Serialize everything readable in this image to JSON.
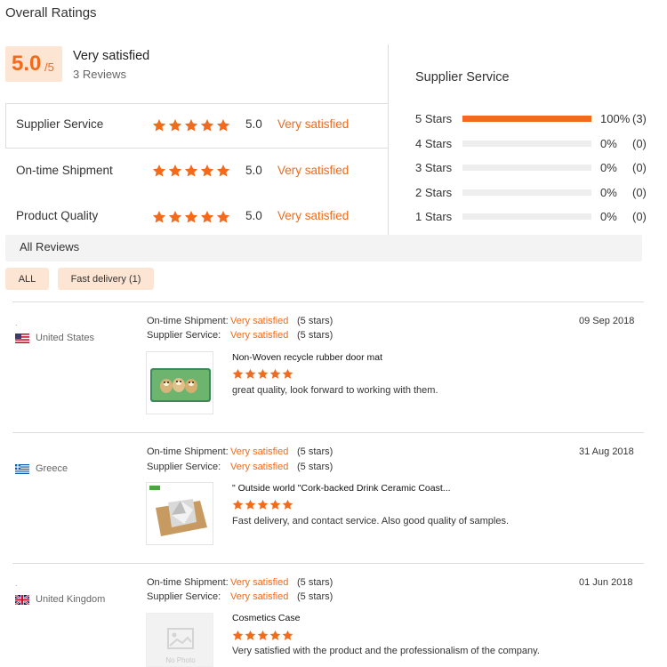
{
  "overall": {
    "title": "Overall Ratings",
    "score": "5.0",
    "score_max": "/5",
    "label": "Very satisfied",
    "count": "3 Reviews"
  },
  "ratings": [
    {
      "label": "Supplier Service",
      "value": "5.0",
      "text": "Very satisfied",
      "stars": 5
    },
    {
      "label": "On-time Shipment",
      "value": "5.0",
      "text": "Very satisfied",
      "stars": 5
    },
    {
      "label": "Product Quality",
      "value": "5.0",
      "text": "Very satisfied",
      "stars": 5
    }
  ],
  "breakdown": {
    "title": "Supplier Service",
    "rows": [
      {
        "label": "5 Stars",
        "fraction": 1.0,
        "pct": "100%",
        "count": "(3)"
      },
      {
        "label": "4 Stars",
        "fraction": 0.0,
        "pct": "0%",
        "count": "(0)"
      },
      {
        "label": "3 Stars",
        "fraction": 0.0,
        "pct": "0%",
        "count": "(0)"
      },
      {
        "label": "2 Stars",
        "fraction": 0.0,
        "pct": "0%",
        "count": "(0)"
      },
      {
        "label": "1 Stars",
        "fraction": 0.0,
        "pct": "0%",
        "count": "(0)"
      }
    ]
  },
  "all_reviews": {
    "title": "All Reviews",
    "filters": [
      "ALL",
      "Fast delivery (1)"
    ]
  },
  "reviews": [
    {
      "dot": ".",
      "country": "United States",
      "shipment_label": "On-time Shipment:",
      "shipment_value": "Very satisfied",
      "shipment_stars": "(5 stars)",
      "service_label": "Supplier Service:",
      "service_value": "Very satisfied",
      "service_stars": "(5 stars)",
      "date": "09 Sep 2018",
      "product": "Non-Woven recycle rubber door mat",
      "text": "great quality, look forward to working with them."
    },
    {
      "dot": "",
      "country": "Greece",
      "shipment_label": "On-time Shipment:",
      "shipment_value": "Very satisfied",
      "shipment_stars": "(5 stars)",
      "service_label": "Supplier Service:",
      "service_value": "Very satisfied",
      "service_stars": "(5 stars)",
      "date": "31 Aug 2018",
      "product": "\" Outside world \"Cork-backed Drink Ceramic Coast...",
      "text": "Fast delivery, and contact service. Also good quality of samples."
    },
    {
      "dot": ".",
      "country": "United Kingdom",
      "shipment_label": "On-time Shipment:",
      "shipment_value": "Very satisfied",
      "shipment_stars": "(5 stars)",
      "service_label": "Supplier Service:",
      "service_value": "Very satisfied",
      "service_stars": "(5 stars)",
      "date": "01 Jun 2018",
      "product": "Cosmetics Case",
      "text": "Very satisfied with the product and the professionalism of the company.",
      "no_photo": "No Photo"
    }
  ],
  "colors": {
    "accent": "#f26a1b",
    "accent_bg": "#fde5d4"
  }
}
